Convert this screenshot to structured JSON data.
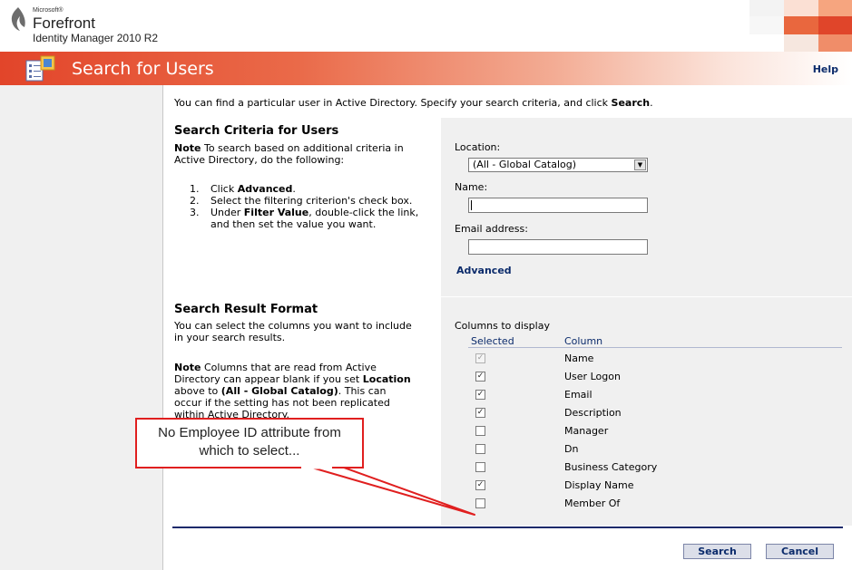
{
  "brand": {
    "ms": "Microsoft®",
    "word": "Forefront",
    "product": "Identity Manager 2010 R2"
  },
  "page": {
    "title": "Search for Users",
    "help": "Help"
  },
  "intro": {
    "pre": "You can find a particular user in Active Directory. Specify your search criteria, and click ",
    "bold": "Search",
    "post": "."
  },
  "criteria": {
    "heading": "Search Criteria for Users",
    "note_label": "Note",
    "note_line1": " To search based on additional criteria in",
    "note_line2": "Active Directory, do the following:",
    "steps": [
      {
        "num": "1.",
        "pre": "Click ",
        "bold": "Advanced",
        "post": "."
      },
      {
        "num": "2.",
        "pre": "Select the filtering criterion's check box.",
        "bold": "",
        "post": ""
      },
      {
        "num": "3.",
        "pre": "Under ",
        "bold": "Filter Value",
        "post": ", double-click the link,"
      }
    ],
    "step3_line2": "and then set the value you want.",
    "location_label": "Location:",
    "location_value": "(All - Global Catalog)",
    "name_label": "Name:",
    "name_value": "",
    "email_label": "Email address:",
    "email_value": "",
    "advanced_link": "Advanced"
  },
  "format": {
    "heading": "Search Result Format",
    "desc_line1": "You can select the columns you want to include",
    "desc_line2": "in your search results.",
    "note_label": "Note",
    "note_l1": " Columns that are read from Active",
    "note_l2a": "Directory can appear blank if you set ",
    "note_l2b": "Location",
    "note_l3a": "above to ",
    "note_l3b": "(All - Global Catalog)",
    "note_l3c": ". This can",
    "note_l4": "occur if the setting has not been replicated",
    "note_l5": "within Active Directory.",
    "columns_label": "Columns to display",
    "selected_header": "Selected",
    "column_header": "Column",
    "columns": [
      {
        "name": "Name",
        "checked": true,
        "disabled": true
      },
      {
        "name": "User Logon",
        "checked": true,
        "disabled": false
      },
      {
        "name": "Email",
        "checked": true,
        "disabled": false
      },
      {
        "name": "Description",
        "checked": true,
        "disabled": false
      },
      {
        "name": "Manager",
        "checked": false,
        "disabled": false
      },
      {
        "name": "Dn",
        "checked": false,
        "disabled": false
      },
      {
        "name": "Business Category",
        "checked": false,
        "disabled": false
      },
      {
        "name": "Display Name",
        "checked": true,
        "disabled": false
      },
      {
        "name": "Member Of",
        "checked": false,
        "disabled": false
      }
    ]
  },
  "buttons": {
    "search": "Search",
    "cancel": "Cancel"
  },
  "callout": {
    "line1": "No Employee ID attribute from",
    "line2": "which to select..."
  },
  "colors": {
    "accent": "#e2452a",
    "link": "#0b2b6b",
    "callout_border": "#e01f1f",
    "pane": "#f0f0f0"
  }
}
